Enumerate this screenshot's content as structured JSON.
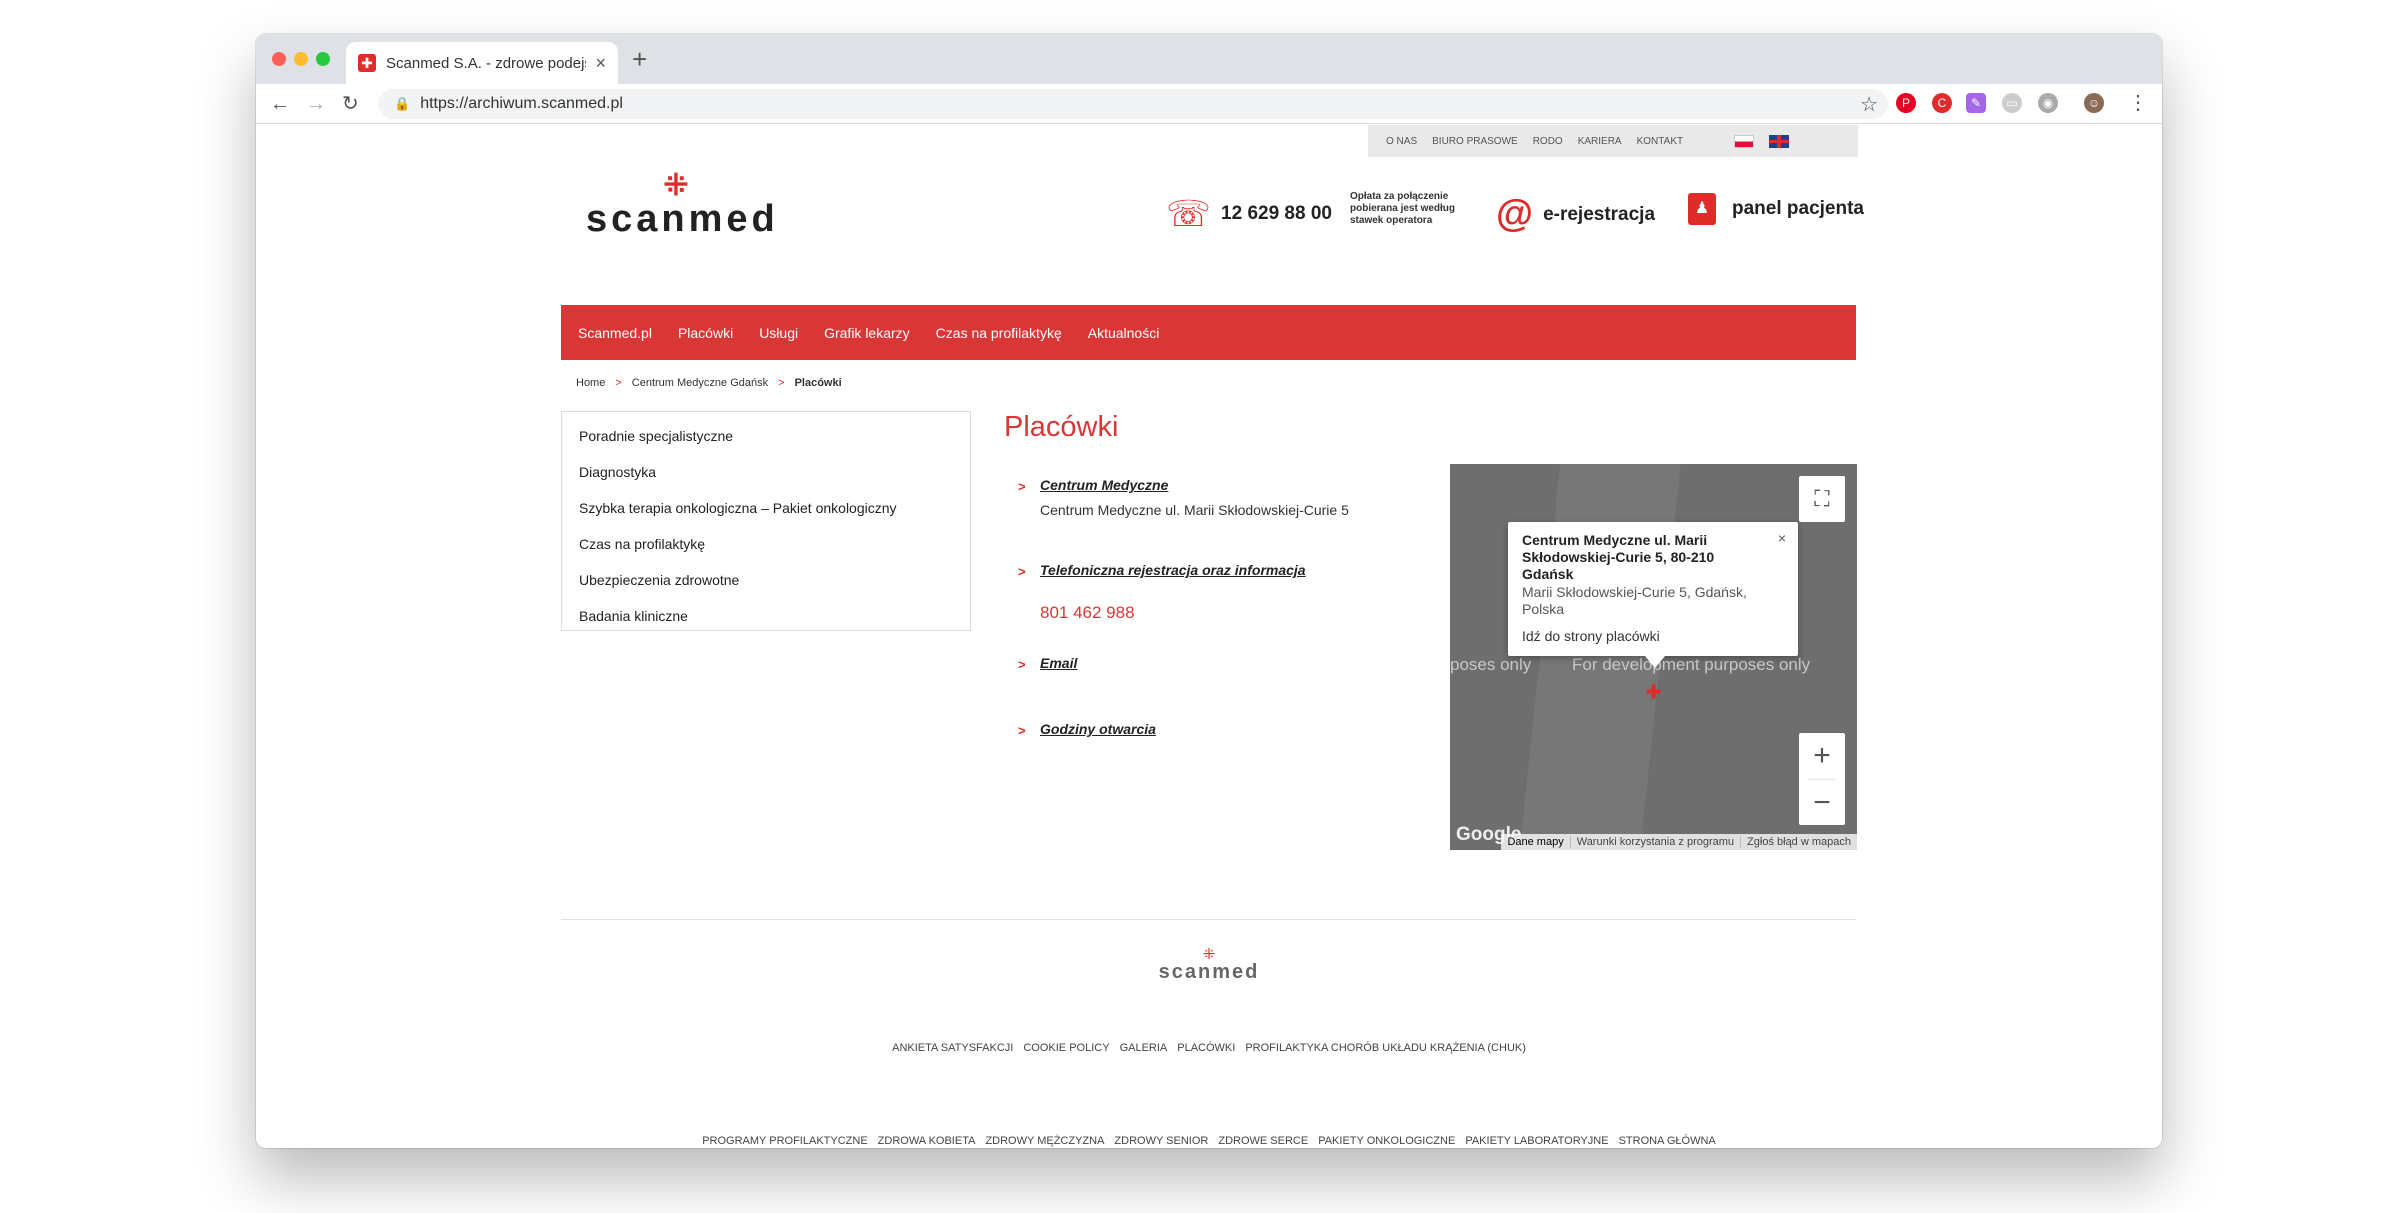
{
  "browser": {
    "tab_title": "Scanmed S.A. - zdrowe podejście",
    "tab_close": "×",
    "new_tab": "+",
    "url": "https://archiwum.scanmed.pl",
    "back": "←",
    "forward": "→",
    "reload": "↻"
  },
  "topbar": {
    "links": [
      "O NAS",
      "BIURO PRASOWE",
      "RODO",
      "KARIERA",
      "KONTAKT"
    ]
  },
  "logo": {
    "text": "scanmed"
  },
  "contact": {
    "phone": "12 629 88 00",
    "fee_note": "Opłata za połączenie pobierana jest według stawek operatora",
    "e_registration": "e-rejestracja",
    "patient_panel": "panel pacjenta"
  },
  "mainnav": [
    "Scanmed.pl",
    "Placówki",
    "Usługi",
    "Grafik lekarzy",
    "Czas na profilaktykę",
    "Aktualności"
  ],
  "breadcrumb": {
    "home": "Home",
    "middle": "Centrum Medyczne Gdańsk",
    "current": "Placówki",
    "sep": ">"
  },
  "sidebar": [
    "Poradnie specjalistyczne",
    "Diagnostyka",
    "Szybka terapia onkologiczna – Pakiet onkologiczny",
    "Czas na profilaktykę",
    "Ubezpieczenia zdrowotne",
    "Badania kliniczne"
  ],
  "content": {
    "title": "Placówki",
    "chev": ">",
    "facility_link": "Centrum Medyczne",
    "facility_address": "Centrum Medyczne ul. Marii Skłodowskiej-Curie 5",
    "phone_link": "Telefoniczna rejestracja oraz informacja",
    "phone_number": "801 462 988",
    "email_link": "Email",
    "hours_link": "Godziny otwarcia"
  },
  "map": {
    "dev_text_left": "poses only",
    "dev_text_right": "For development purposes only",
    "popup_title": "Centrum Medyczne ul. Marii Skłodowskiej-Curie 5, 80-210 Gdańsk",
    "popup_address": "Marii Skłodowskiej-Curie 5, Gdańsk, Polska",
    "popup_link": "Idź do strony placówki",
    "popup_close": "×",
    "google": "Google",
    "attribution": [
      "Dane mapy",
      "Warunki korzystania z programu",
      "Zgłoś błąd w mapach"
    ],
    "zoom_in": "+",
    "zoom_out": "−"
  },
  "footer": {
    "logo_text": "scanmed",
    "links_row1": [
      "ANKIETA SATYSFAKCJI",
      "COOKIE POLICY",
      "GALERIA",
      "PLACÓWKI",
      "PROFILAKTYKA CHORÓB UKŁADU KRĄŻENIA (CHUK)"
    ],
    "links_row2": [
      "PROGRAMY PROFILAKTYCZNE",
      "ZDROWA KOBIETA",
      "ZDROWY MĘŻCZYZNA",
      "ZDROWY SENIOR",
      "ZDROWE SERCE",
      "PAKIETY ONKOLOGICZNE",
      "PAKIETY LABORATORYJNE",
      "STRONA GŁÓWNA"
    ]
  },
  "colors": {
    "brand_red": "#d93636",
    "accent_red": "#e02b2b"
  }
}
